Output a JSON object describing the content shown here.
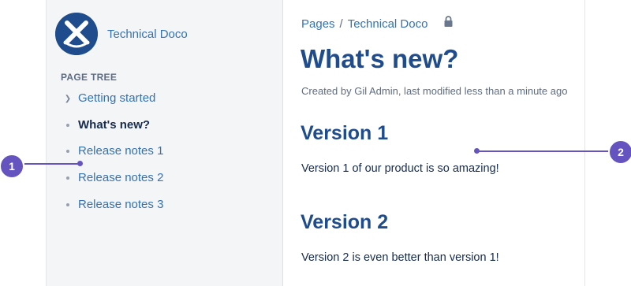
{
  "space": {
    "name": "Technical Doco"
  },
  "sidebar": {
    "tree_heading": "PAGE TREE",
    "items": [
      {
        "label": "Getting started",
        "marker": "chevron-right-icon"
      },
      {
        "label": "What's new?",
        "marker": "bullet",
        "current": true
      },
      {
        "label": "Release notes 1",
        "marker": "bullet"
      },
      {
        "label": "Release notes 2",
        "marker": "bullet"
      },
      {
        "label": "Release notes 3",
        "marker": "bullet"
      }
    ]
  },
  "breadcrumbs": {
    "items": [
      "Pages",
      "Technical Doco"
    ],
    "separator": "/",
    "icon": "lock-icon"
  },
  "page": {
    "title": "What's new?",
    "byline": "Created by Gil Admin, last modified less than a minute ago",
    "sections": [
      {
        "heading": "Version 1",
        "text": "Version 1 of our product is so amazing!"
      },
      {
        "heading": "Version 2",
        "text": "Version 2 is even better than version 1!"
      }
    ]
  },
  "callouts": [
    {
      "number": "1"
    },
    {
      "number": "2"
    }
  ],
  "colors": {
    "brand": "#1f4c8d",
    "link": "#3572b0",
    "callout": "#6554c0",
    "sidebar_bg": "#f4f5f7"
  }
}
